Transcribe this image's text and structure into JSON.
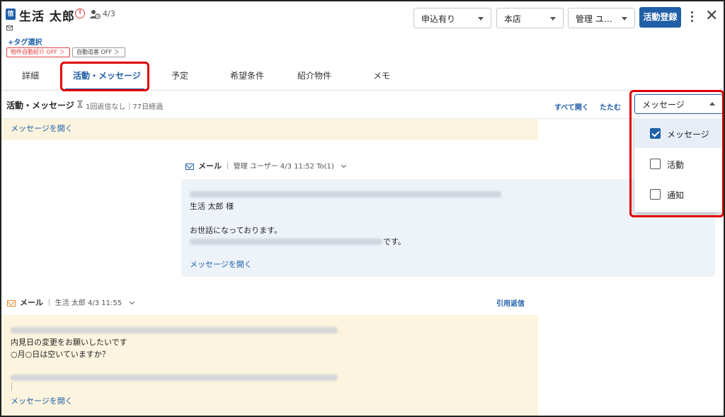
{
  "header": {
    "doc_icon": "信",
    "customer_name": "生活 太郎",
    "alert_glyph": "!",
    "person_date": "4/3",
    "tag_link": "+タグ選択",
    "chip_auto_intro": "物件自動紹介 OFF ＞",
    "chip_auto_follow": "自動追客 OFF ＞",
    "select_application": "申込有り",
    "select_store": "本店",
    "select_user": "管理 ユ…",
    "register_button": "活動登録",
    "close_glyph": "✕"
  },
  "tabs": [
    {
      "label": "詳細"
    },
    {
      "label": "活動・メッセージ",
      "active": true
    },
    {
      "label": "予定"
    },
    {
      "label": "希望条件"
    },
    {
      "label": "紹介物件"
    },
    {
      "label": "メモ"
    }
  ],
  "section": {
    "title": "活動・メッセージ",
    "meta": "1回返信なし｜77日経過",
    "open_all": "すべて開く",
    "collapse": "たたむ"
  },
  "messages": {
    "open_message": "メッセージを開く",
    "mail1": {
      "label": "メール",
      "meta": "｜ 管理 ユーザー  4/3 11:52  To(1)",
      "line_name": "生活 太郎 様",
      "line_greeting": "お世話になっております。",
      "line_desu": "です。"
    },
    "mail2": {
      "label": "メール",
      "meta": "｜ 生活 太郎  4/3 11:55",
      "quote_reply": "引用返信",
      "line1": "内見日の変更をお願いしたいです",
      "line2": "○月○日は空いていますか？"
    }
  },
  "filter_dropdown": {
    "selected": "メッセージ",
    "options": [
      {
        "label": "メッセージ",
        "checked": true
      },
      {
        "label": "活動",
        "checked": false
      },
      {
        "label": "通知",
        "checked": false
      }
    ]
  },
  "colors": {
    "primary": "#1f5fa8",
    "highlight_red": "#e00000",
    "yellow_band": "#fcf4de",
    "blue_card": "#eef3fa"
  }
}
